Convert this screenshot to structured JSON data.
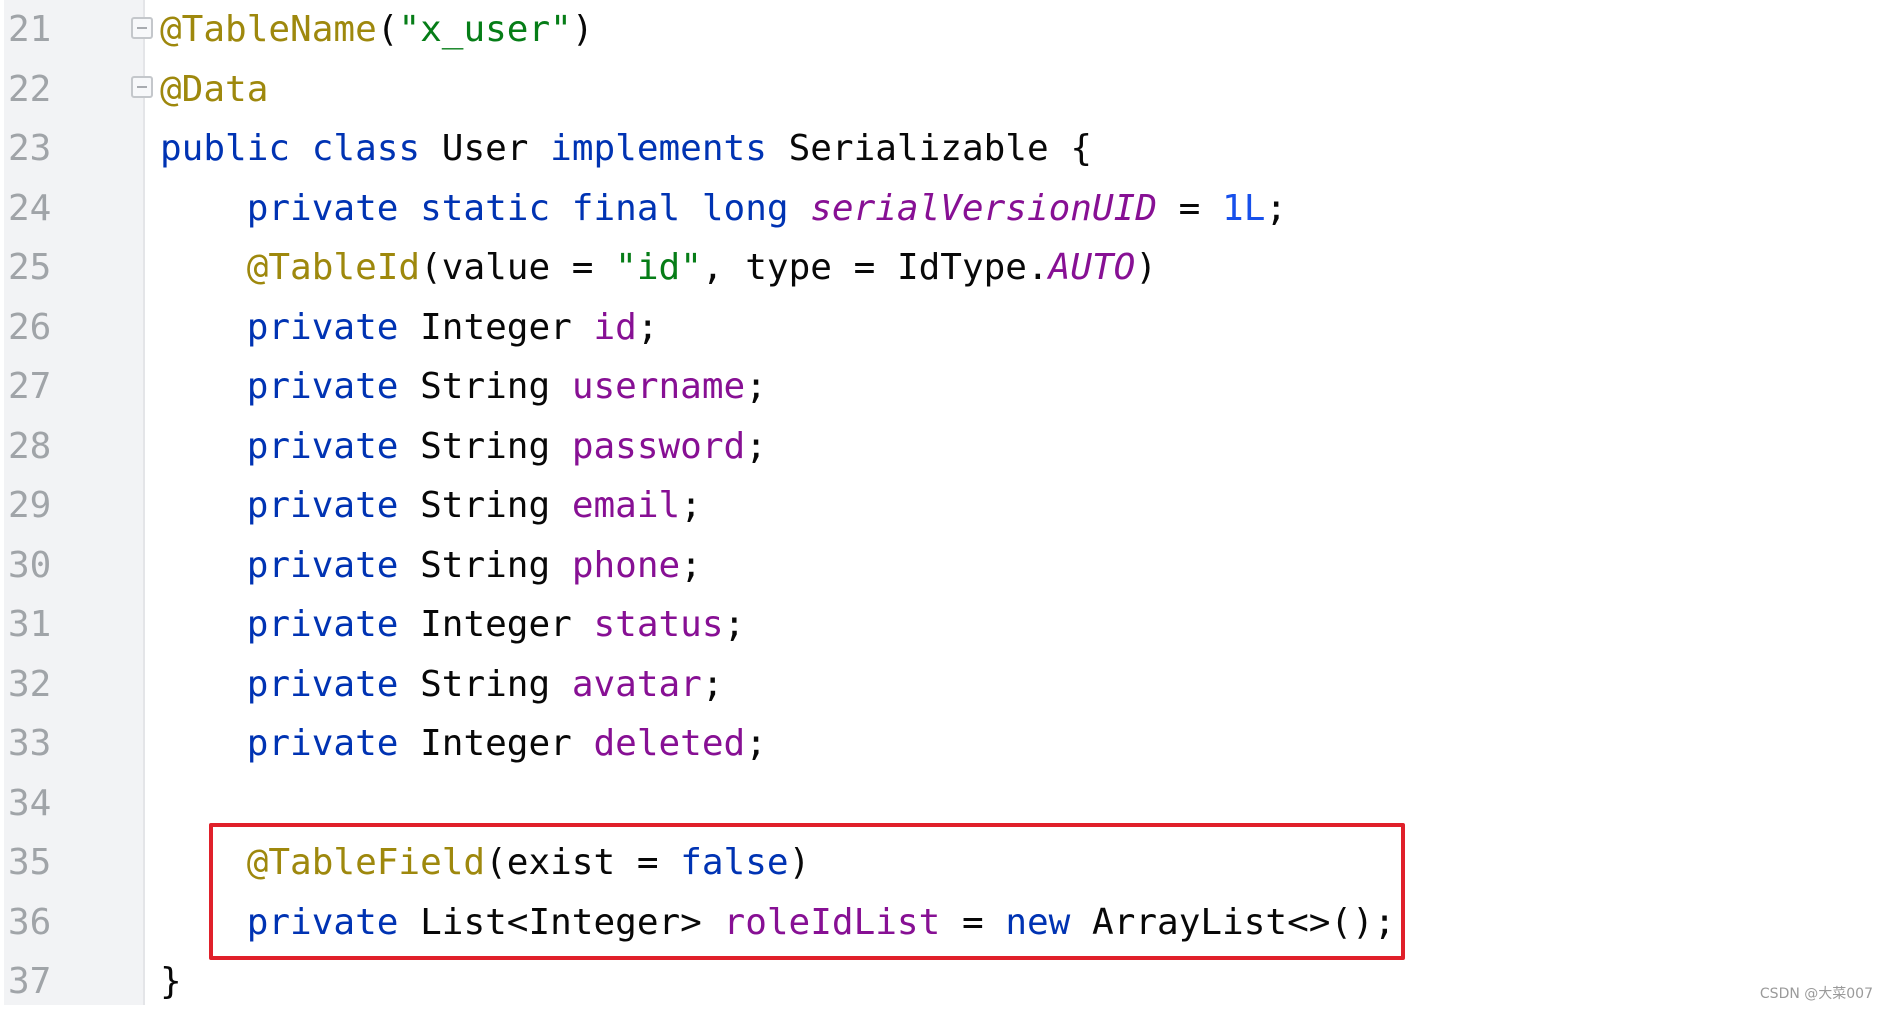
{
  "editor": {
    "line_numbers": [
      "21",
      "22",
      "23",
      "24",
      "25",
      "26",
      "27",
      "28",
      "29",
      "30",
      "31",
      "32",
      "33",
      "34",
      "35",
      "36",
      "37"
    ],
    "lines": [
      {
        "tokens": [
          {
            "t": "@TableName",
            "c": "ann"
          },
          {
            "t": "(",
            "c": "plain"
          },
          {
            "t": "\"x_user\"",
            "c": "str"
          },
          {
            "t": ")",
            "c": "plain"
          }
        ]
      },
      {
        "tokens": [
          {
            "t": "@Data",
            "c": "ann"
          }
        ]
      },
      {
        "tokens": [
          {
            "t": "public class ",
            "c": "kw"
          },
          {
            "t": "User ",
            "c": "plain"
          },
          {
            "t": "implements ",
            "c": "kw"
          },
          {
            "t": "Serializable {",
            "c": "plain"
          }
        ]
      },
      {
        "tokens": [
          {
            "t": "    private static final long ",
            "c": "kw"
          },
          {
            "t": "serialVersionUID",
            "c": "fld ital"
          },
          {
            "t": " = ",
            "c": "plain"
          },
          {
            "t": "1L",
            "c": "num"
          },
          {
            "t": ";",
            "c": "plain"
          }
        ]
      },
      {
        "tokens": [
          {
            "t": "    @TableId",
            "c": "ann"
          },
          {
            "t": "(value = ",
            "c": "plain"
          },
          {
            "t": "\"id\"",
            "c": "str"
          },
          {
            "t": ", type = IdType.",
            "c": "plain"
          },
          {
            "t": "AUTO",
            "c": "fld ital"
          },
          {
            "t": ")",
            "c": "plain"
          }
        ]
      },
      {
        "tokens": [
          {
            "t": "    private ",
            "c": "kw"
          },
          {
            "t": "Integer ",
            "c": "plain"
          },
          {
            "t": "id",
            "c": "fld"
          },
          {
            "t": ";",
            "c": "plain"
          }
        ]
      },
      {
        "tokens": [
          {
            "t": "    private ",
            "c": "kw"
          },
          {
            "t": "String ",
            "c": "plain"
          },
          {
            "t": "username",
            "c": "fld"
          },
          {
            "t": ";",
            "c": "plain"
          }
        ]
      },
      {
        "tokens": [
          {
            "t": "    private ",
            "c": "kw"
          },
          {
            "t": "String ",
            "c": "plain"
          },
          {
            "t": "password",
            "c": "fld"
          },
          {
            "t": ";",
            "c": "plain"
          }
        ]
      },
      {
        "tokens": [
          {
            "t": "    private ",
            "c": "kw"
          },
          {
            "t": "String ",
            "c": "plain"
          },
          {
            "t": "email",
            "c": "fld"
          },
          {
            "t": ";",
            "c": "plain"
          }
        ]
      },
      {
        "tokens": [
          {
            "t": "    private ",
            "c": "kw"
          },
          {
            "t": "String ",
            "c": "plain"
          },
          {
            "t": "phone",
            "c": "fld"
          },
          {
            "t": ";",
            "c": "plain"
          }
        ]
      },
      {
        "tokens": [
          {
            "t": "    private ",
            "c": "kw"
          },
          {
            "t": "Integer ",
            "c": "plain"
          },
          {
            "t": "status",
            "c": "fld"
          },
          {
            "t": ";",
            "c": "plain"
          }
        ]
      },
      {
        "tokens": [
          {
            "t": "    private ",
            "c": "kw"
          },
          {
            "t": "String ",
            "c": "plain"
          },
          {
            "t": "avatar",
            "c": "fld"
          },
          {
            "t": ";",
            "c": "plain"
          }
        ]
      },
      {
        "tokens": [
          {
            "t": "    private ",
            "c": "kw"
          },
          {
            "t": "Integer ",
            "c": "plain"
          },
          {
            "t": "deleted",
            "c": "fld"
          },
          {
            "t": ";",
            "c": "plain"
          }
        ]
      },
      {
        "tokens": [
          {
            "t": "",
            "c": "plain"
          }
        ]
      },
      {
        "tokens": [
          {
            "t": "    @TableField",
            "c": "ann"
          },
          {
            "t": "(exist = ",
            "c": "plain"
          },
          {
            "t": "false",
            "c": "kw"
          },
          {
            "t": ")",
            "c": "plain"
          }
        ]
      },
      {
        "tokens": [
          {
            "t": "    private ",
            "c": "kw"
          },
          {
            "t": "List<Integer> ",
            "c": "plain"
          },
          {
            "t": "roleIdList",
            "c": "fld"
          },
          {
            "t": " = ",
            "c": "plain"
          },
          {
            "t": "new ",
            "c": "kw"
          },
          {
            "t": "ArrayList<>();",
            "c": "plain"
          }
        ]
      },
      {
        "tokens": [
          {
            "t": "}",
            "c": "plain"
          }
        ]
      }
    ]
  },
  "colors": {
    "keyword": "#0033b3",
    "annotation": "#9e880d",
    "string": "#067d17",
    "field": "#871094",
    "number": "#1750eb",
    "highlight_border": "#e0202a"
  },
  "watermark": "CSDN @大菜007"
}
